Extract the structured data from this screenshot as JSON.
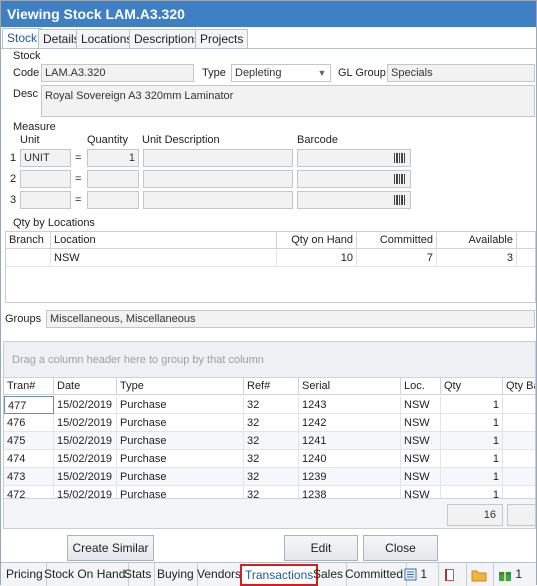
{
  "window": {
    "title": "Viewing Stock LAM.A3.320"
  },
  "tabs": [
    "Stock",
    "Details",
    "Locations",
    "Descriptions",
    "Projects"
  ],
  "stock": {
    "group_title": "Stock",
    "code_label": "Code",
    "code_value": "LAM.A3.320",
    "type_label": "Type",
    "type_value": "Depleting",
    "gl_label": "GL Group",
    "gl_value": "Specials",
    "desc_label": "Desc",
    "desc_value": "Royal Sovereign A3 320mm Laminator"
  },
  "measure": {
    "group_title": "Measure",
    "col_unit": "Unit",
    "col_quantity": "Quantity",
    "col_unit_desc": "Unit Description",
    "col_barcode": "Barcode",
    "rows": [
      {
        "num": "1",
        "unit": "UNIT",
        "eq": "=",
        "qty": "1"
      },
      {
        "num": "2",
        "unit": "",
        "eq": "=",
        "qty": ""
      },
      {
        "num": "3",
        "unit": "",
        "eq": "=",
        "qty": ""
      }
    ]
  },
  "locations": {
    "group_title": "Qty by Locations",
    "headers": [
      "Branch",
      "Location",
      "Qty on Hand",
      "Committed",
      "Available"
    ],
    "rows": [
      {
        "branch": "",
        "location": "NSW",
        "qty": "10",
        "committed": "7",
        "available": "3"
      }
    ]
  },
  "groups": {
    "label": "Groups",
    "value": "Miscellaneous, Miscellaneous"
  },
  "transactions": {
    "drag_hint": "Drag a column header here to group by that column",
    "headers": [
      "Tran#",
      "Date",
      "Type",
      "Ref#",
      "Serial",
      "Loc.",
      "Qty",
      "Qty Ba"
    ],
    "rows": [
      {
        "tran": "477",
        "date": "15/02/2019",
        "type": "Purchase",
        "ref": "32",
        "serial": "1243",
        "loc": "NSW",
        "qty": "1"
      },
      {
        "tran": "476",
        "date": "15/02/2019",
        "type": "Purchase",
        "ref": "32",
        "serial": "1242",
        "loc": "NSW",
        "qty": "1"
      },
      {
        "tran": "475",
        "date": "15/02/2019",
        "type": "Purchase",
        "ref": "32",
        "serial": "1241",
        "loc": "NSW",
        "qty": "1"
      },
      {
        "tran": "474",
        "date": "15/02/2019",
        "type": "Purchase",
        "ref": "32",
        "serial": "1240",
        "loc": "NSW",
        "qty": "1"
      },
      {
        "tran": "473",
        "date": "15/02/2019",
        "type": "Purchase",
        "ref": "32",
        "serial": "1239",
        "loc": "NSW",
        "qty": "1"
      },
      {
        "tran": "472",
        "date": "15/02/2019",
        "type": "Purchase",
        "ref": "32",
        "serial": "1238",
        "loc": "NSW",
        "qty": "1"
      }
    ],
    "total_qty": "16"
  },
  "buttons": {
    "create_similar": "Create Similar",
    "edit": "Edit",
    "close": "Close"
  },
  "bottom_tabs": {
    "pricing": "Pricing",
    "stock_on_hand": "Stock On Hand",
    "stats": "Stats",
    "buying": "Buying",
    "vendors": "Vendors",
    "transactions": "Transactions",
    "sales": "Sales",
    "committed": "Committed",
    "notes_count": "1",
    "files_count": "1"
  },
  "colors": {
    "titlebar": "#3f7fc3",
    "active_tab_text": "#1f5aa5",
    "highlight_border": "#d21f1f"
  }
}
